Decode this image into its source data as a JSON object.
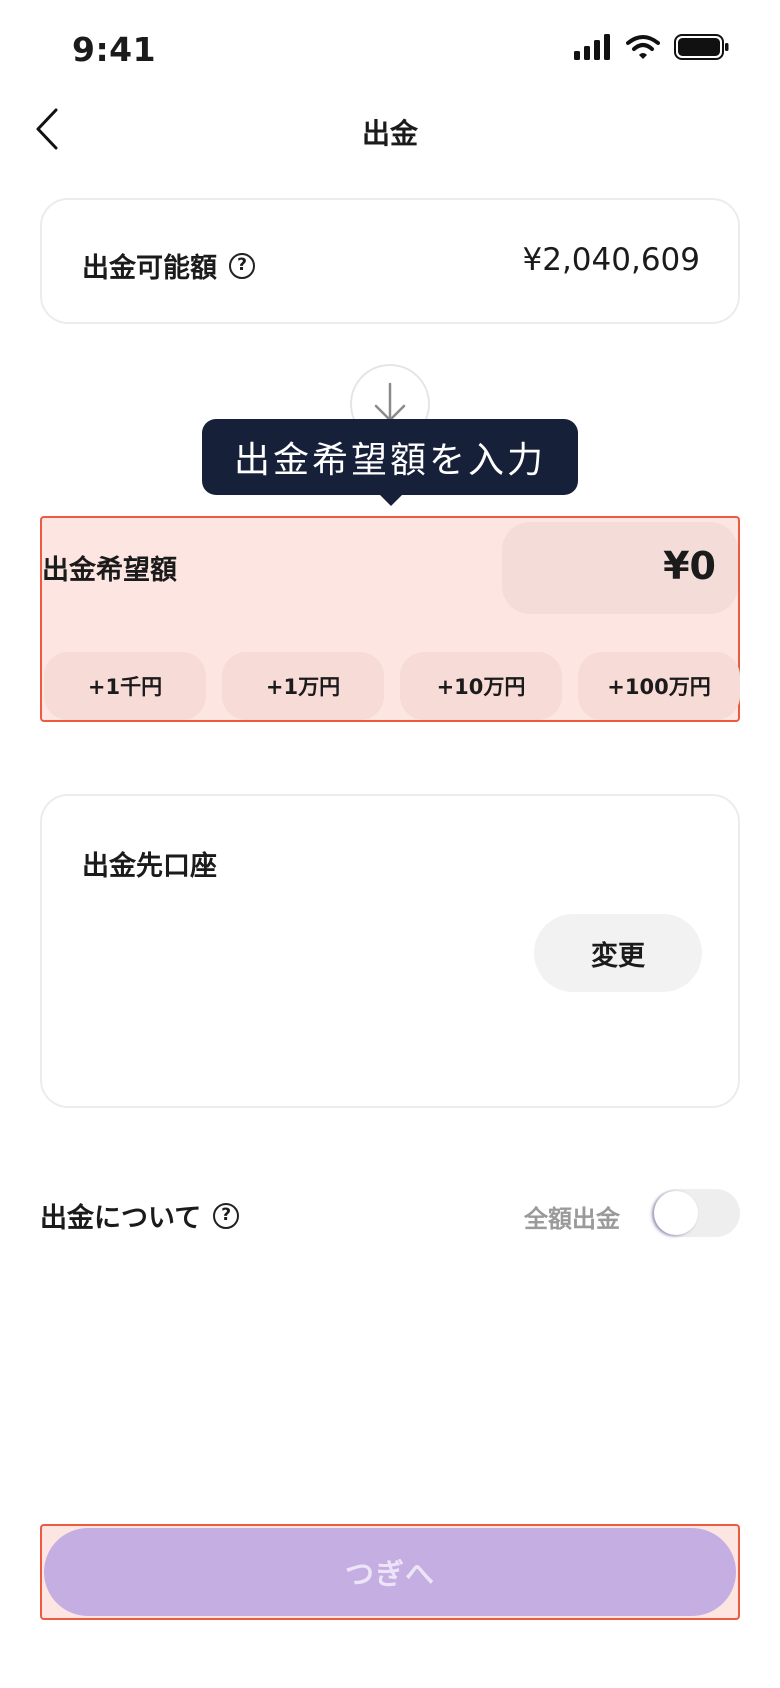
{
  "status_bar": {
    "time": "9:41",
    "icons": [
      "signal-icon",
      "wifi-icon",
      "battery-icon"
    ]
  },
  "header": {
    "title": "出金",
    "back_icon": "chevron-left-icon"
  },
  "available": {
    "label": "出金可能額",
    "help_icon": "?",
    "value": "¥2,040,609"
  },
  "tooltip": {
    "text": "出金希望額を入力"
  },
  "amount": {
    "label": "出金希望額",
    "value": "¥0",
    "chips": [
      "+1千円",
      "+1万円",
      "+10万円",
      "+100万円"
    ]
  },
  "destination": {
    "label": "出金先口座",
    "change_label": "変更"
  },
  "about": {
    "label": "出金について",
    "help_icon": "?",
    "full_withdraw_label": "全額出金",
    "full_withdraw_on": false
  },
  "next_button": {
    "label": "つぎへ"
  },
  "colors": {
    "accent": "#c4aee2",
    "highlight_border": "#ec5a3f",
    "highlight_fill": "#fde6e2",
    "tooltip_bg": "#162139"
  }
}
